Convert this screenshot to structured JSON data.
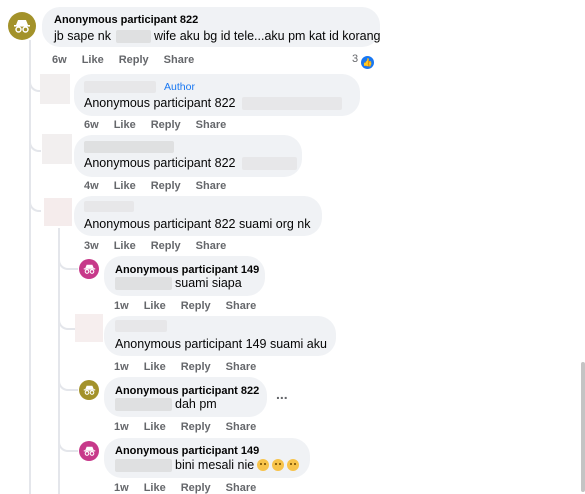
{
  "comments": [
    {
      "name": "Anonymous participant 822",
      "text": "jb sape nk",
      "text2": "wife aku bg id tele...aku pm kat id korang",
      "time": "6w",
      "like": "Like",
      "reply": "Reply",
      "share": "Share",
      "reactions": "3"
    },
    {
      "badge": "Author",
      "text": "Anonymous participant 822",
      "time": "6w",
      "like": "Like",
      "reply": "Reply",
      "share": "Share"
    },
    {
      "text": "Anonymous participant 822",
      "time": "4w",
      "like": "Like",
      "reply": "Reply",
      "share": "Share"
    },
    {
      "text": "Anonymous participant 822 suami org nk",
      "time": "3w",
      "like": "Like",
      "reply": "Reply",
      "share": "Share"
    },
    {
      "name": "Anonymous participant 149",
      "text": "suami siapa",
      "time": "1w",
      "like": "Like",
      "reply": "Reply",
      "share": "Share"
    },
    {
      "text": "Anonymous participant 149 suami aku",
      "time": "1w",
      "like": "Like",
      "reply": "Reply",
      "share": "Share"
    },
    {
      "name": "Anonymous participant 822",
      "text": "dah pm",
      "time": "1w",
      "like": "Like",
      "reply": "Reply",
      "share": "Share",
      "more": "..."
    },
    {
      "name": "Anonymous participant 149",
      "text": "bini mesali nie",
      "time": "1w",
      "like": "Like",
      "reply": "Reply",
      "share": "Share"
    }
  ],
  "colors": {
    "anon822": "#a3922a",
    "anon149": "#c7398a",
    "like_blue": "#1877f2",
    "bubble": "#f0f2f5"
  }
}
